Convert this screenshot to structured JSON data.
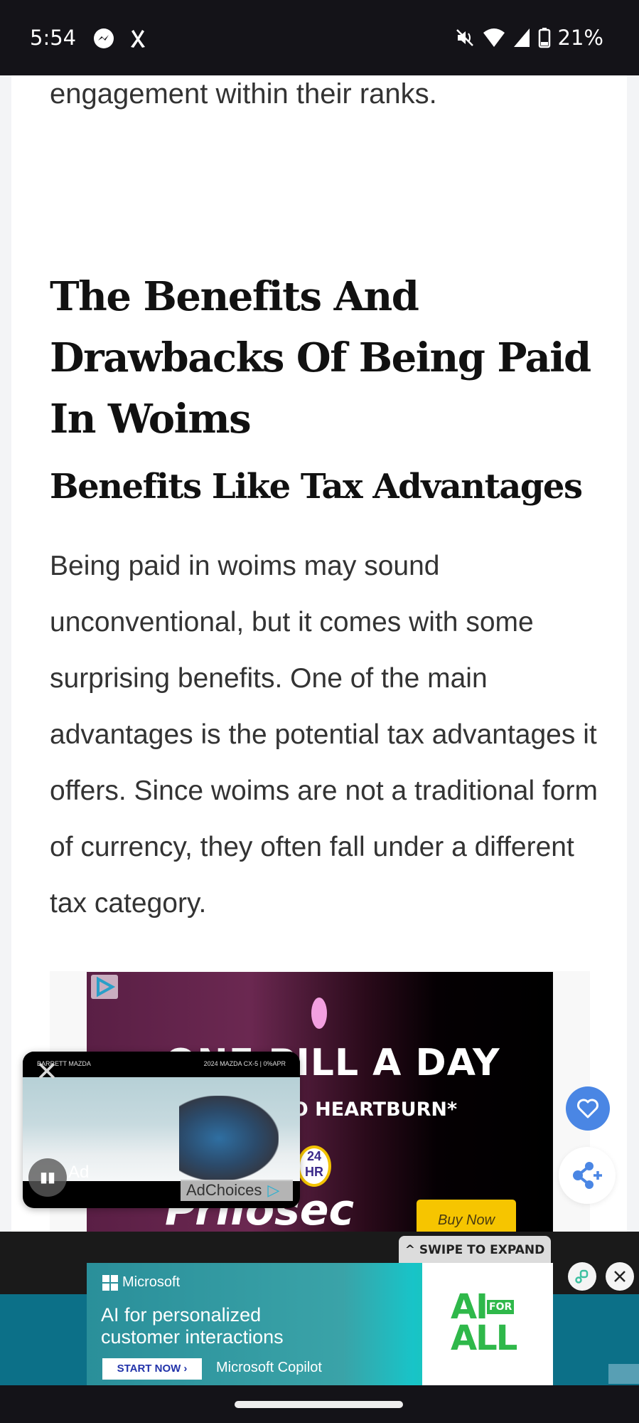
{
  "status_bar": {
    "time": "5:54",
    "left_icons": [
      "messenger-icon",
      "app-icon"
    ],
    "right_icons": [
      "vibrate-off-icon",
      "wifi-icon",
      "signal-icon",
      "battery-icon"
    ],
    "battery": "21%"
  },
  "article": {
    "lead_fragment": "engagement within their ranks.",
    "h2": "The Benefits And Drawbacks Of Being Paid In Woims",
    "h3": "Benefits Like Tax Advantages",
    "paragraph": "Being paid in woims may sound unconventional, but it comes with some surprising benefits. One of the main advantages is the potential tax advantages it offers. Since woims are not a traditional form of currency, they often fall under a different tax category."
  },
  "ads": {
    "prilosec": {
      "headline": "ONE PILL A DAY",
      "sub": "ZERO HEARTBURN*",
      "brand": "Prilosec",
      "badge_top": "24",
      "badge_bottom": "HR",
      "cta": "Buy Now"
    },
    "video": {
      "sponsor": "BARRETT MAZDA",
      "title": "2024 MAZDA CX-5 | 0%APR",
      "ad_label": "Ad",
      "adchoices": "AdChoices"
    },
    "sticky": {
      "swipe_label": "SWIPE TO EXPAND",
      "brand": "Microsoft",
      "headline_line1": "AI for personalized",
      "headline_line2": "customer interactions",
      "cta": "START NOW ›",
      "product": "Microsoft Copilot",
      "tagline_big": "AI",
      "tagline_small": "FOR",
      "tagline_end": "ALL"
    }
  },
  "colors": {
    "fab_blue": "#4a86e4",
    "sticky_teal": "#0c7088",
    "status_bg": "#141318"
  }
}
